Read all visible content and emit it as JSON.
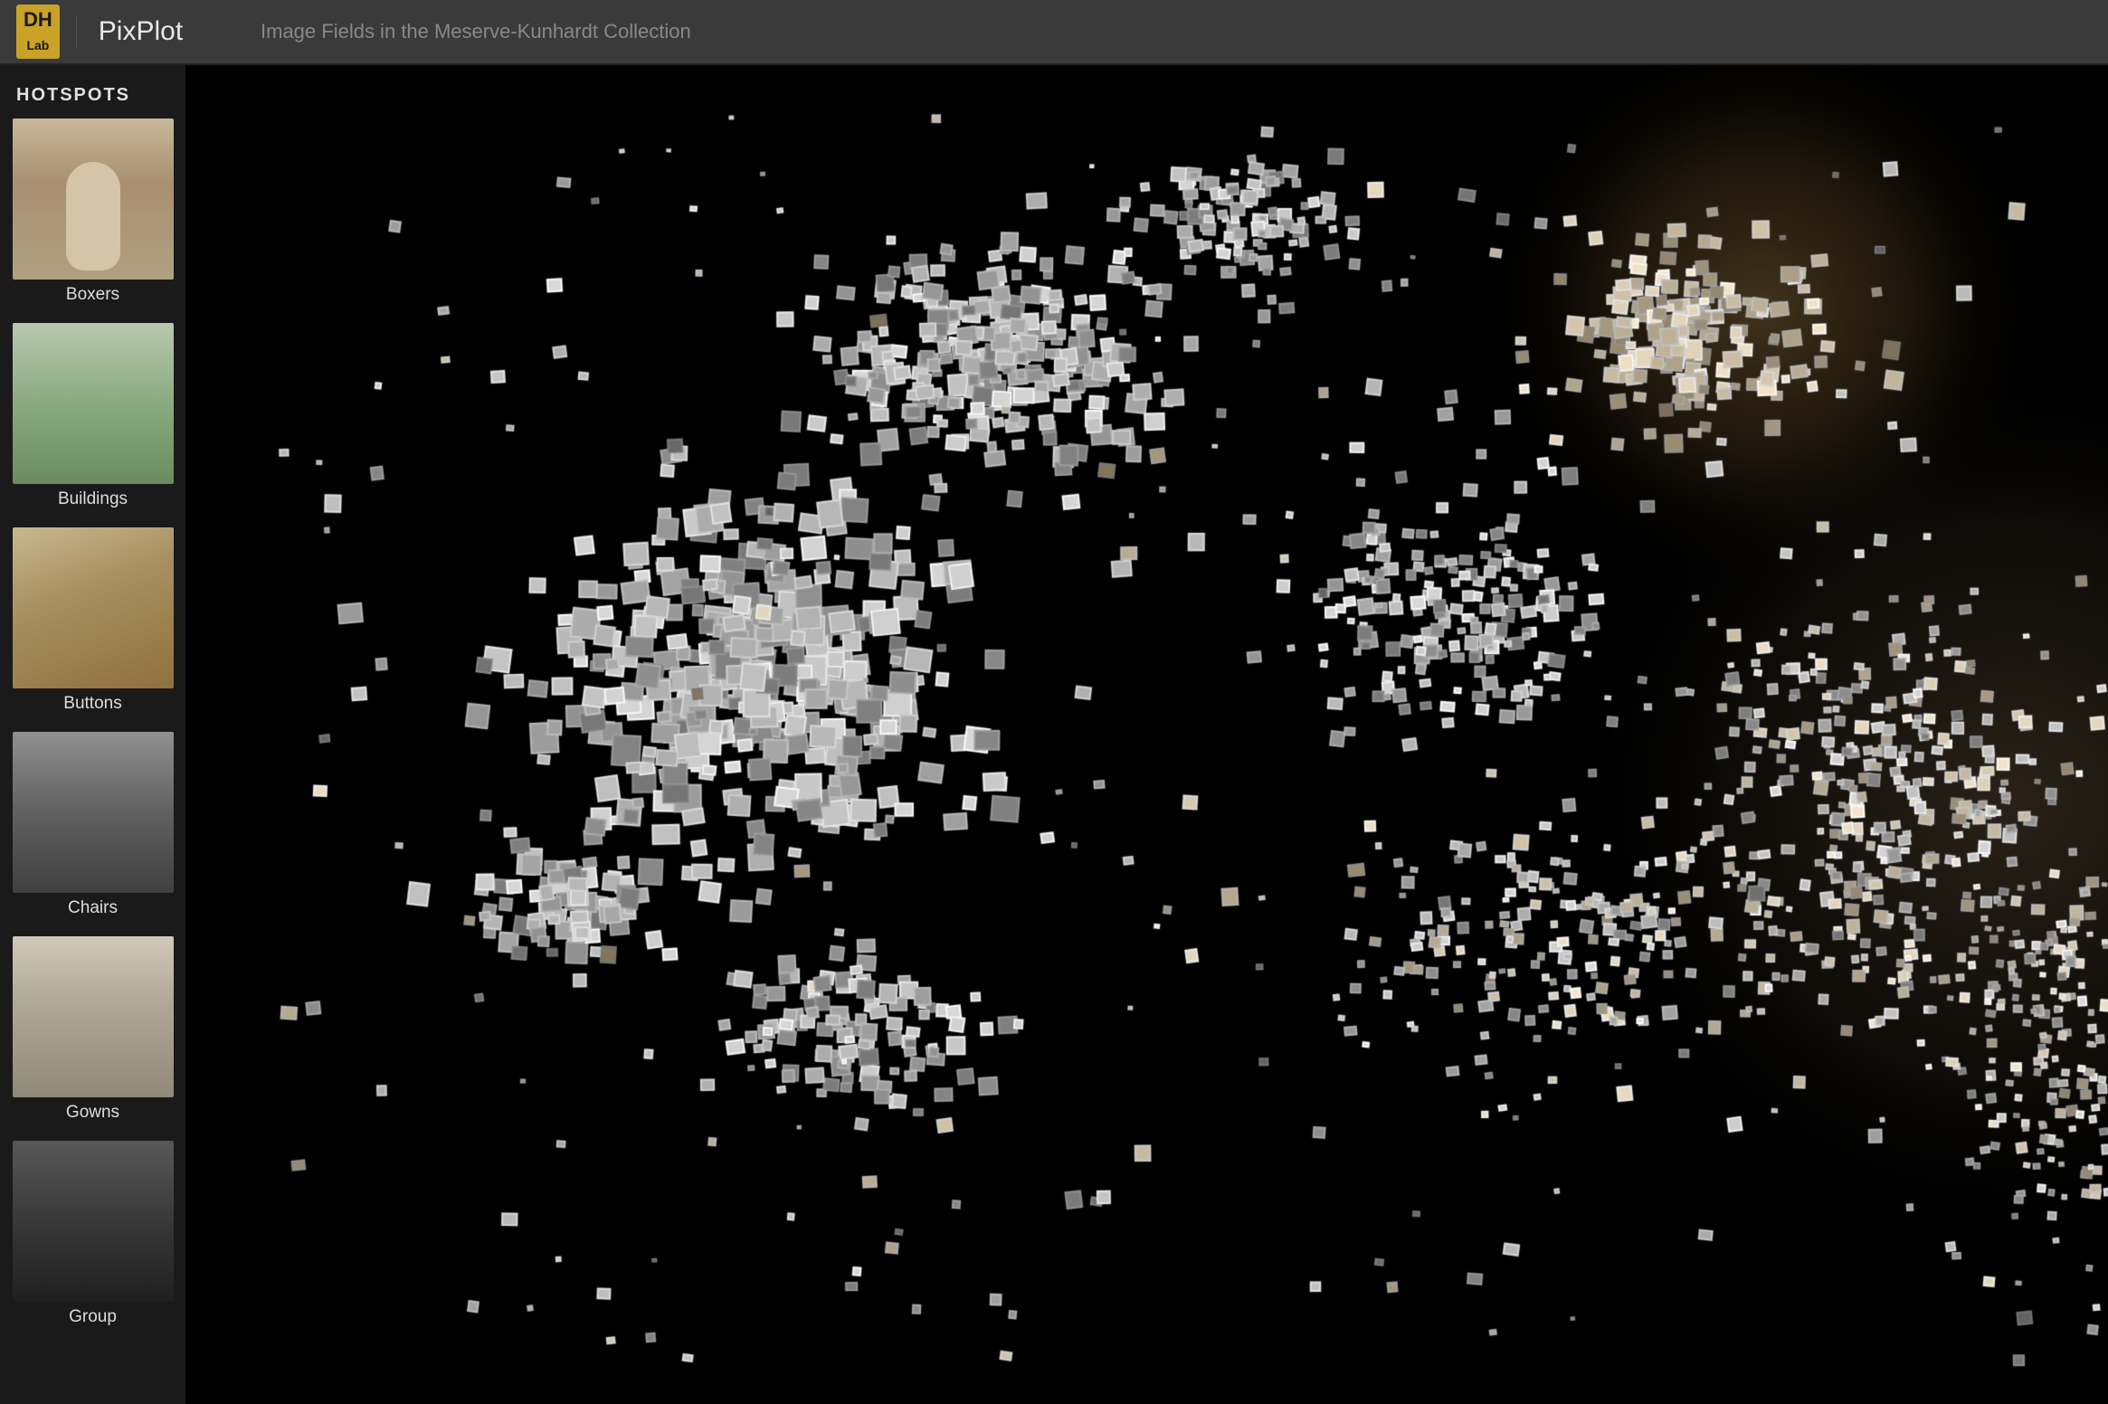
{
  "header": {
    "logo_line1": "DH",
    "logo_line2": "Lab",
    "app_title": "PixPlot",
    "subtitle": "Image Fields in the Meserve-Kunhardt Collection"
  },
  "sidebar": {
    "section_label": "HOTSPOTS",
    "items": [
      {
        "id": "boxers",
        "label": "Boxers",
        "thumb_class": "thumb-boxers"
      },
      {
        "id": "buildings",
        "label": "Buildings",
        "thumb_class": "thumb-buildings"
      },
      {
        "id": "buttons",
        "label": "Buttons",
        "thumb_class": "thumb-buttons"
      },
      {
        "id": "chairs",
        "label": "Chairs",
        "thumb_class": "thumb-chairs"
      },
      {
        "id": "gowns",
        "label": "Gowns",
        "thumb_class": "thumb-gowns"
      },
      {
        "id": "group",
        "label": "Group",
        "thumb_class": "thumb-group"
      }
    ]
  },
  "canvas": {
    "alt": "Scatter plot of image thumbnails from the Meserve-Kunhardt Collection"
  }
}
